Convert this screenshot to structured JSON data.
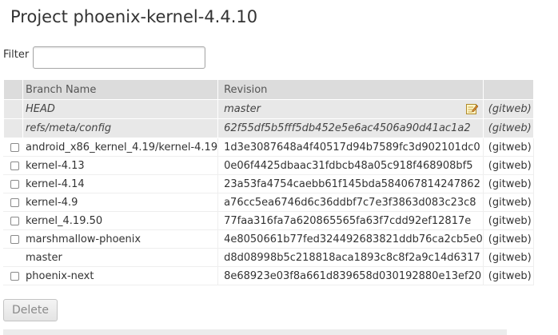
{
  "page": {
    "title": "Project phoenix-kernel-4.4.10"
  },
  "filter": {
    "label": "Filter",
    "value": "",
    "placeholder": ""
  },
  "table": {
    "headers": {
      "branch_name": "Branch Name",
      "revision": "Revision",
      "web": ""
    },
    "special_rows": [
      {
        "name": "HEAD",
        "revision": "master",
        "web": "(gitweb)",
        "has_edit": true
      },
      {
        "name": "refs/meta/config",
        "revision": "62f55df5b5fff5db452e5e6ac4506a90d41ac1a2",
        "web": "(gitweb)",
        "has_edit": false
      }
    ],
    "rows": [
      {
        "name": "android_x86_kernel_4.19/kernel-4.19",
        "revision": "1d3e3087648a4f40517d94b7589fc3d902101dc0",
        "web": "(gitweb)",
        "checkbox": true,
        "checked": false
      },
      {
        "name": "kernel-4.13",
        "revision": "0e06f4425dbaac31fdbcb48a05c918f468908bf5",
        "web": "(gitweb)",
        "checkbox": true,
        "checked": false
      },
      {
        "name": "kernel-4.14",
        "revision": "23a53fa4754caebb61f145bda584067814247862",
        "web": "(gitweb)",
        "checkbox": true,
        "checked": false
      },
      {
        "name": "kernel-4.9",
        "revision": "a76cc5ea6746d6c36ddbf7c7e3f3863d083c23c8",
        "web": "(gitweb)",
        "checkbox": true,
        "checked": false
      },
      {
        "name": "kernel_4.19.50",
        "revision": "77faa316fa7a620865565fa63f7cdd92ef12817e",
        "web": "(gitweb)",
        "checkbox": true,
        "checked": false
      },
      {
        "name": "marshmallow-phoenix",
        "revision": "4e8050661b77fed324492683821ddb76ca2cb5e0",
        "web": "(gitweb)",
        "checkbox": true,
        "checked": false
      },
      {
        "name": "master",
        "revision": "d8d08998b5c218818aca1893c8c8f2a9c14d6317",
        "web": "(gitweb)",
        "checkbox": false,
        "checked": false
      },
      {
        "name": "phoenix-next",
        "revision": "8e68923e03f8a661d839658d030192880e13ef20",
        "web": "(gitweb)",
        "checkbox": true,
        "checked": false
      }
    ]
  },
  "actions": {
    "delete_label": "Delete"
  },
  "colors": {
    "header_bg": "#dcdcdc",
    "special_row_bg": "#e8e8e8",
    "disabled_text": "#8a8a8a"
  }
}
